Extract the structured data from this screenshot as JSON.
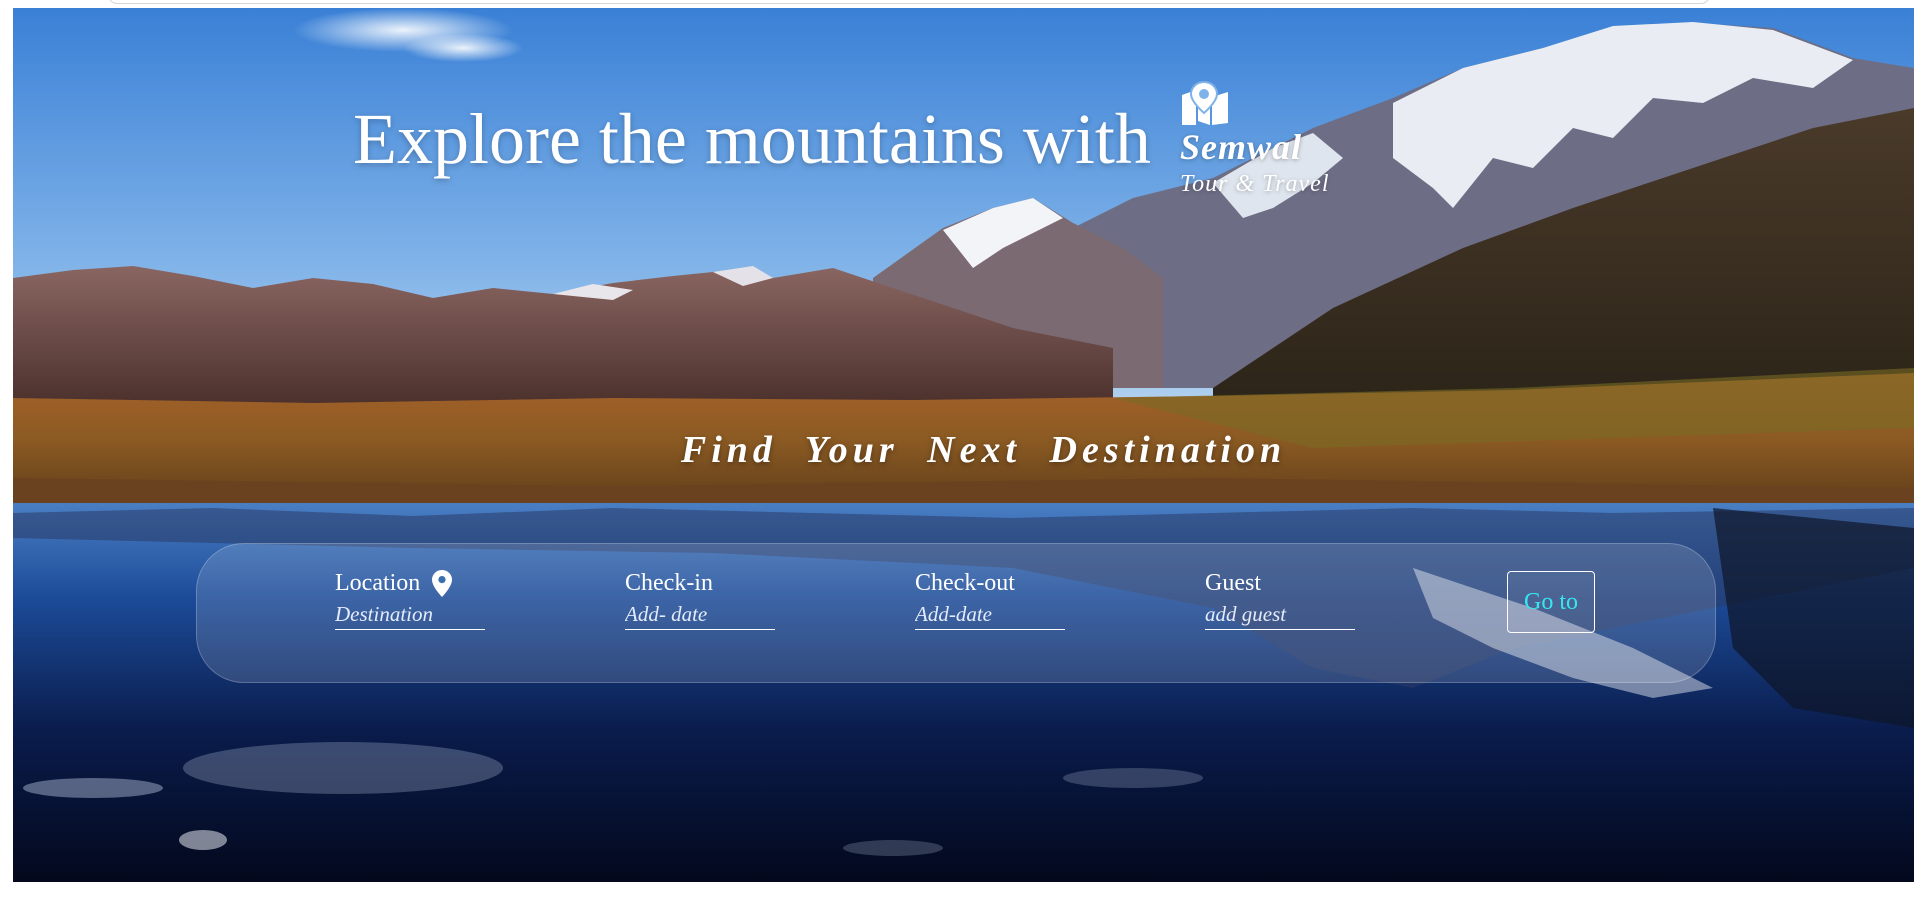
{
  "hero": {
    "title": "Explore the mountains with",
    "brand": {
      "name": "Semwal",
      "tagline": "Tour & Travel",
      "icon": "map-pin-icon"
    },
    "subtitle": "Find Your Next Destination"
  },
  "search": {
    "fields": [
      {
        "label": "Location",
        "placeholder": "Destination",
        "icon": "location-pin-icon"
      },
      {
        "label": "Check-in",
        "placeholder": "Add- date"
      },
      {
        "label": "Check-out",
        "placeholder": "Add-date"
      },
      {
        "label": "Guest",
        "placeholder": "add guest"
      }
    ],
    "button_label": "Go to"
  },
  "colors": {
    "text": "#ffffff",
    "button_text": "#35e6f2",
    "sky_top": "#3f86d8",
    "water": "#0b1740"
  }
}
